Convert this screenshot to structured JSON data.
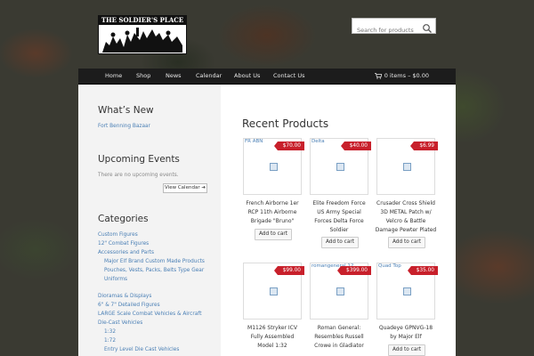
{
  "brand": {
    "logo_text": "THE SOLDIER'S PLACE"
  },
  "search": {
    "placeholder": "Search for products"
  },
  "nav": {
    "items": [
      "Home",
      "Shop",
      "News",
      "Calendar",
      "About Us",
      "Contact Us"
    ]
  },
  "cart": {
    "label": "0 items – $0.00"
  },
  "sidebar": {
    "whats_new": {
      "title": "What’s New",
      "link": "Fort Benning Bazaar"
    },
    "events": {
      "title": "Upcoming Events",
      "empty": "There are no upcoming events.",
      "button": "View Calendar"
    },
    "categories": {
      "title": "Categories",
      "items": [
        "Custom Figures",
        "12\" Combat Figures",
        "Accessories and Parts",
        "Major Elf Brand Custom Made Products",
        "Pouches, Vests, Packs, Belts Type Gear",
        "Uniforms",
        "Dioramas & Displays",
        "6\" & 7\" Detailed Figures",
        "LARGE Scale Combat Vehicles & Aircraft",
        "Die-Cast Vehicles",
        "1:32",
        "1:72",
        "Entry Level Die Cast Vehicles"
      ]
    }
  },
  "main": {
    "title": "Recent Products",
    "products": [
      {
        "alt": "FR ABN",
        "price": "$70.00",
        "name_lines": [
          "French Airborne 1er",
          "RCP 11th Airborne",
          "Brigade \"Bruno\""
        ],
        "button": "Add to cart"
      },
      {
        "alt": "Delta",
        "price": "$40.00",
        "name_lines": [
          "Elite Freedom Force",
          "US Army Special",
          "Forces Delta Force",
          "Soldier"
        ],
        "button": "Add to cart"
      },
      {
        "alt": "",
        "price": "$6.99",
        "name_lines": [
          "Crusader Cross Shield",
          "3D METAL Patch w/",
          "Velcro & Battle",
          "Damage Pewter Plated"
        ],
        "button": "Add to cart"
      },
      {
        "alt": "",
        "price": "$99.00",
        "name_lines": [
          "M1126 Stryker ICV",
          "Fully Assembled",
          "Model 1:32"
        ],
        "button": ""
      },
      {
        "alt": "romangeneral 12",
        "price": "$399.00",
        "name_lines": [
          "Roman General:",
          "Resembles Russell",
          "Crowe in Gladiator"
        ],
        "button": ""
      },
      {
        "alt": "Quad Top",
        "price": "$35.00",
        "name_lines": [
          "Quadeye GPNVG-18",
          "by Major Elf"
        ],
        "button": "Add to cart"
      }
    ]
  },
  "colors": {
    "accent_red": "#c8202b",
    "link_blue": "#4a7fb5",
    "nav_bg": "#1c1c1c"
  }
}
